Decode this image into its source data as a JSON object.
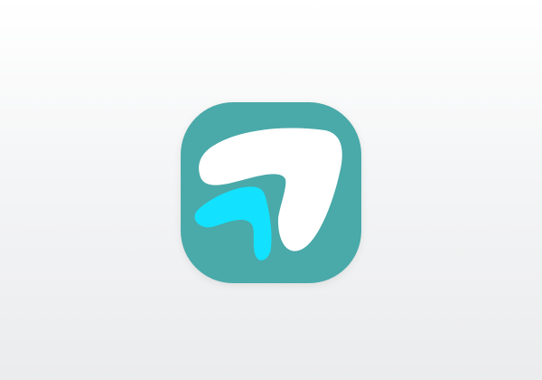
{
  "icon": {
    "name": "boomerang-arrows-app-icon",
    "colors": {
      "tile": "#4aa9a9",
      "large_shape": "#ffffff",
      "small_shape": "#12e2ff"
    }
  },
  "background": {
    "top": "#ffffff",
    "bottom": "#ebeced"
  }
}
